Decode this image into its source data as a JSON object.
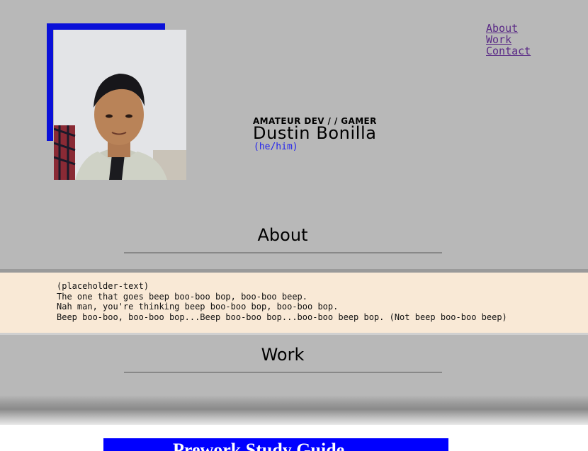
{
  "nav": {
    "items": [
      "About",
      "Work",
      "Contact"
    ]
  },
  "hero": {
    "tagline": "AMATEUR DEV / / GAMER",
    "name": "Dustin Bonilla",
    "pronouns": "(he/him)"
  },
  "sections": {
    "about_title": "About",
    "about_lines": [
      "(placeholder-text)",
      "The one that goes beep boo-boo bop, boo-boo beep.",
      "Nah man, you're thinking beep boo-boo bop, boo-boo bop.",
      "Beep boo-boo, boo-boo bop...Beep boo-boo bop...boo-boo beep bop. (Not beep boo-boo beep)"
    ],
    "work_title": "Work"
  },
  "work": {
    "banner_text": "Prework Study Guide"
  },
  "colors": {
    "accent_blue": "#0a10d8",
    "panel_bg": "#f9e9d6",
    "page_bg": "#b8b8b8"
  }
}
